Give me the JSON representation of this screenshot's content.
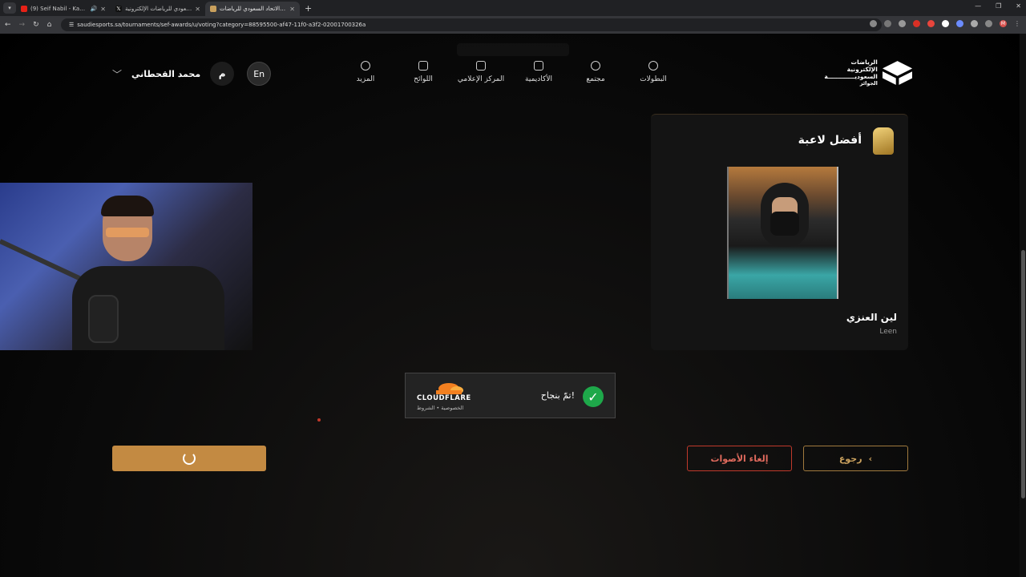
{
  "browser": {
    "tabs": [
      {
        "title": "(9) Seif Nabil - Kabi Youm",
        "icon": "youtube-icon",
        "active": false
      },
      {
        "title": "الاتحاد السعودي للرياضات الإلكترونية",
        "icon": "x-icon",
        "active": false
      },
      {
        "title": "جوائز الاتحاد السعودي للرياضات",
        "icon": "site-icon",
        "active": true
      }
    ],
    "url": "saudiesports.sa/tournaments/sef-awards/u/voting?category=88595500-af47-11f0-a3f2-02001700326a",
    "profile_initial": "M"
  },
  "header": {
    "logo_line1": "الرياضات الإلكترونية",
    "logo_line2": "السعوديـــــــــــــة",
    "logo_line3": "الجوائز",
    "nav": [
      {
        "label": "البطولات",
        "icon": "gamepad-icon"
      },
      {
        "label": "مجتمع",
        "icon": "community-icon"
      },
      {
        "label": "الأكاديمية",
        "icon": "academy-icon"
      },
      {
        "label": "المركز الإعلامي",
        "icon": "media-icon"
      },
      {
        "label": "اللوائح",
        "icon": "rules-icon"
      },
      {
        "label": "المزيد",
        "icon": "info-icon"
      }
    ],
    "user_name": "محمد القحطاني",
    "avatar_initial": "م",
    "lang": "En"
  },
  "card": {
    "title": "أفضل لاعبة",
    "player_name": "لين العنزي",
    "player_sub": "Leen"
  },
  "captcha": {
    "success_text": "تمّ بنجاح!",
    "brand": "CLOUDFLARE",
    "links": "الخصوصية • الشروط"
  },
  "actions": {
    "cancel_label": "إلغاء الأصوات",
    "back_label": "رجوع"
  },
  "colors": {
    "accent": "#c38a42",
    "danger": "#c0392b",
    "success": "#1ea84a"
  }
}
